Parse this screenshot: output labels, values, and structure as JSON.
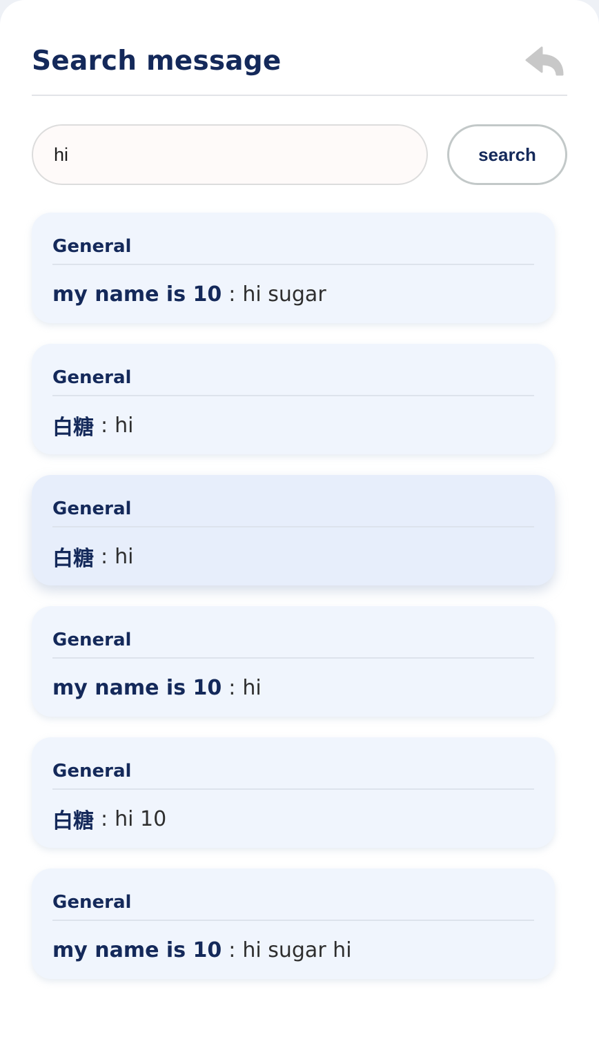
{
  "header": {
    "title": "Search message",
    "back_icon": "reply-arrow-icon"
  },
  "search": {
    "value": "hi",
    "button_label": "search"
  },
  "results": [
    {
      "channel": "General",
      "sender": "my name is 10",
      "separator": ":",
      "text": "hi sugar",
      "active": false
    },
    {
      "channel": "General",
      "sender": "白糖",
      "separator": ":",
      "text": "hi",
      "active": false
    },
    {
      "channel": "General",
      "sender": "白糖",
      "separator": ":",
      "text": "hi",
      "active": true
    },
    {
      "channel": "General",
      "sender": "my name is 10",
      "separator": ":",
      "text": "hi",
      "active": false
    },
    {
      "channel": "General",
      "sender": "白糖",
      "separator": ":",
      "text": "hi 10",
      "active": false
    },
    {
      "channel": "General",
      "sender": "my name is 10",
      "separator": ":",
      "text": "hi sugar hi",
      "active": false
    }
  ],
  "colors": {
    "accent": "#14295a",
    "card_bg": "#f0f5fd",
    "card_active_bg": "#e7eefb",
    "input_bg": "#fefaf9",
    "icon_gray": "#c8c8c8"
  }
}
